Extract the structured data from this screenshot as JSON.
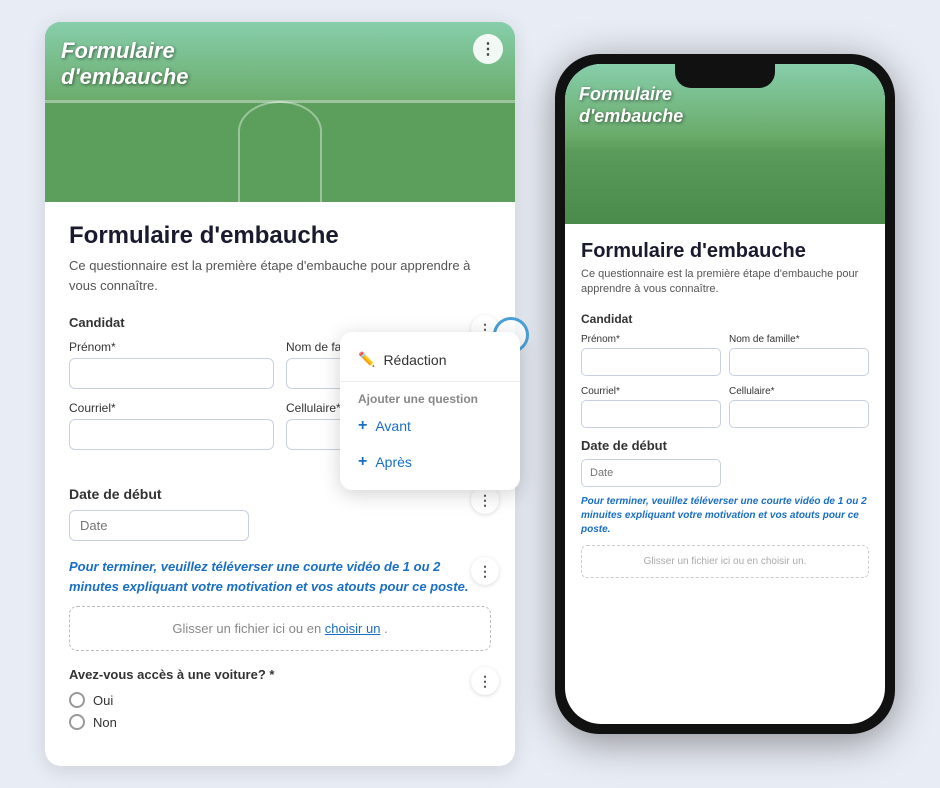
{
  "app": {
    "bg_color": "#e8ecf4"
  },
  "hero": {
    "title_line1": "Formulaire",
    "title_line2": "d'embauche"
  },
  "form": {
    "title": "Formulaire d'embauche",
    "description": "Ce questionnaire est la première étape d'embauche pour apprendre à vous connaître.",
    "candidat_label": "Candidat",
    "prenom_label": "Prénom*",
    "nom_label": "Nom de famille*",
    "courriel_label": "Courriel*",
    "cellulaire_label": "Cellulaire*",
    "date_label": "Date de début",
    "date_placeholder": "Date",
    "video_text_before": "Pour terminer, veuillez téléverser une courte vidéo de 1 ou 2 minutes expliquant ",
    "video_text_bold": "votre motivation et vos atouts pour ce poste.",
    "file_upload_text": "Glisser un fichier ici ou en ",
    "file_upload_link": "choisir un",
    "voiture_label": "Avez-vous accès à une voiture? *",
    "oui_label": "Oui",
    "non_label": "Non"
  },
  "context_menu": {
    "redaction_label": "Rédaction",
    "add_question_label": "Ajouter une question",
    "avant_label": "Avant",
    "apres_label": "Après",
    "edit_icon": "✏️"
  },
  "phone": {
    "hero_title_line1": "Formulaire",
    "hero_title_line2": "d'embauche",
    "form_title": "Formulaire d'embauche",
    "form_desc": "Ce questionnaire est la première étape d'embauche pour apprendre à vous connaître.",
    "candidat_label": "Candidat",
    "prenom_label": "Prénom*",
    "nom_label": "Nom de famille*",
    "courriel_label": "Courriel*",
    "cellulaire_label": "Cellulaire*",
    "date_label": "Date de début",
    "date_placeholder": "Date",
    "video_text_before": "Pour terminer, veuillez téléverser une courte vidéo de 1 ou 2 mi",
    "video_text_bold": "nuites expliquant votre motivation et vos atouts pour ce poste.",
    "file_text": "Glisser un fichier ici ou en choisir un."
  }
}
